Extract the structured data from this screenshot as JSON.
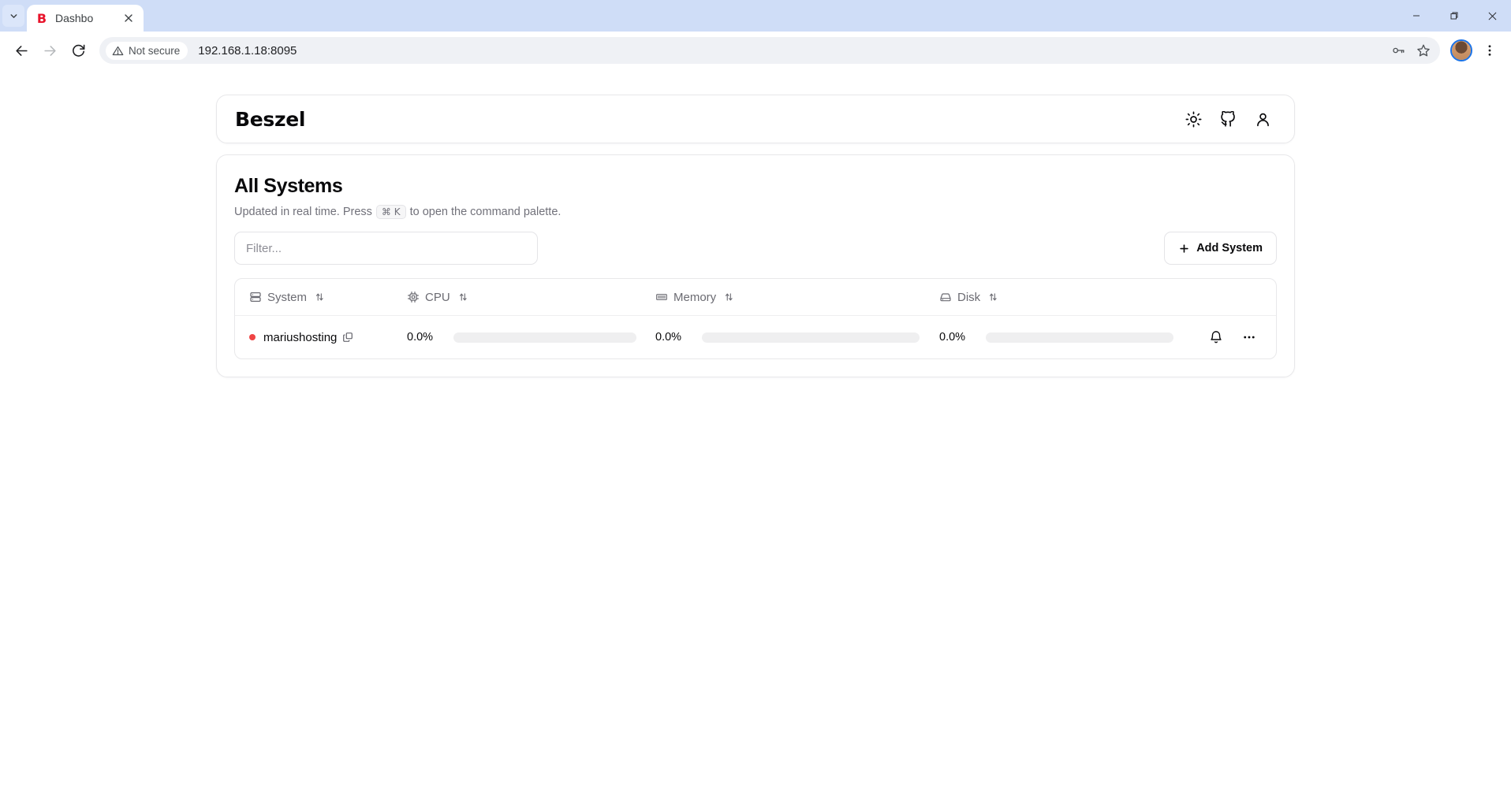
{
  "browser": {
    "tab": {
      "title": "Dashbo",
      "favicon_letter": "B",
      "favicon_color": "#e8132b"
    },
    "tab_list_icon": "chevron-down-icon",
    "tab_close_icon": "close-icon",
    "nav": {
      "back": "back-arrow-icon",
      "forward": "forward-arrow-icon",
      "reload": "reload-icon"
    },
    "omnibox": {
      "security_label": "Not secure",
      "security_icon": "warning-triangle-icon",
      "url": "192.168.1.18:8095",
      "password_icon": "key-icon",
      "bookmark_icon": "star-icon"
    },
    "profile_icon": "profile-avatar",
    "menu_icon": "three-dots-vertical-icon",
    "window": {
      "minimize": "minimize-icon",
      "restore": "restore-icon",
      "close": "close-icon"
    }
  },
  "app": {
    "logo": "Beszel",
    "header_actions": [
      {
        "name": "theme-toggle",
        "icon": "sun-icon"
      },
      {
        "name": "github-link",
        "icon": "github-icon"
      },
      {
        "name": "account-menu",
        "icon": "user-icon"
      }
    ]
  },
  "main": {
    "title": "All Systems",
    "subtitle_before": "Updated in real time. Press",
    "shortcut_key": "⌘ K",
    "subtitle_after": "to open the command palette.",
    "filter": {
      "placeholder": "Filter...",
      "value": ""
    },
    "add_button": {
      "label": "Add System",
      "icon": "plus-icon"
    }
  },
  "table": {
    "columns": [
      {
        "key": "system",
        "label": "System",
        "icon": "server-icon",
        "sort_icon": "sort-updown-icon"
      },
      {
        "key": "cpu",
        "label": "CPU",
        "icon": "cpu-chip-icon",
        "sort_icon": "sort-updown-icon"
      },
      {
        "key": "memory",
        "label": "Memory",
        "icon": "memory-stick-icon",
        "sort_icon": "sort-updown-icon"
      },
      {
        "key": "disk",
        "label": "Disk",
        "icon": "hard-drive-icon",
        "sort_icon": "sort-updown-icon"
      }
    ],
    "rows": [
      {
        "name": "mariushosting",
        "status": "offline",
        "status_color": "#ef4444",
        "badge_icon": "copy-layers-icon",
        "cpu": "0.0%",
        "cpu_value": 0,
        "memory": "0.0%",
        "memory_value": 0,
        "disk": "0.0%",
        "disk_value": 0,
        "actions": [
          {
            "name": "alerts-button",
            "icon": "bell-icon"
          },
          {
            "name": "row-menu-button",
            "icon": "three-dots-horizontal-icon"
          }
        ]
      }
    ]
  }
}
